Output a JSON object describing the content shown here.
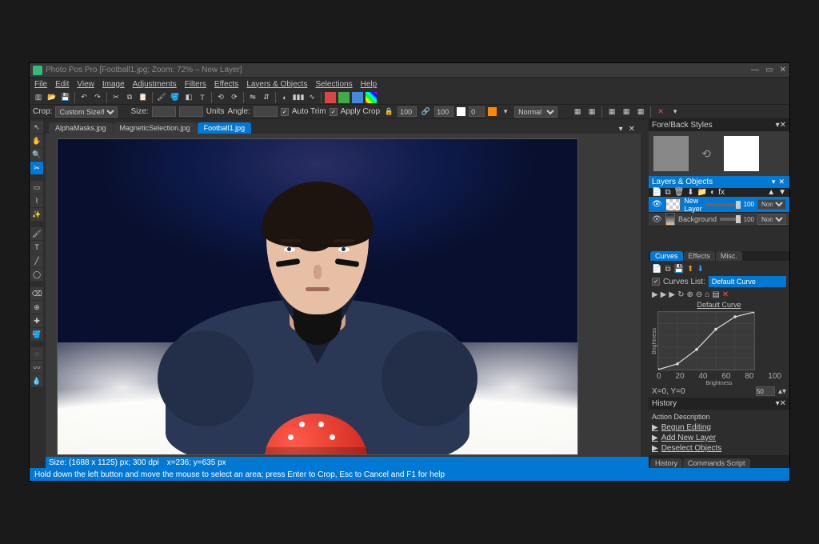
{
  "title": "Photo Pos Pro  [Football1.jpg; Zoom: 72% – New Layer]",
  "menu": [
    "File",
    "Edit",
    "View",
    "Image",
    "Adjustments",
    "Filters",
    "Effects",
    "Layers & Objects",
    "Selections",
    "Help"
  ],
  "crop_bar": {
    "crop_lbl": "Crop:",
    "crop_mode": "Custom Size/Ratio",
    "size_lbl": "Size:",
    "size_w": "",
    "size_h": "",
    "units": "Units",
    "angle_lbl": "Angle:",
    "angle": "",
    "auto_trim": "Auto Trim",
    "apply_crop": "Apply Crop",
    "w_val": "100",
    "h_val": "100",
    "opacity_val": "0",
    "blend_mode": "Normal"
  },
  "tabs": [
    "AlphaMasks.jpg",
    "MagneticSelection.jpg",
    "Football1.jpg"
  ],
  "active_tab": 2,
  "fore_back": {
    "title": "Fore/Back Styles"
  },
  "layers_panel": {
    "title": "Layers & Objects",
    "layers": [
      {
        "name": "New Layer",
        "opacity": 100,
        "selected": true,
        "checker": true
      },
      {
        "name": "Background",
        "opacity": 100,
        "selected": false,
        "checker": false
      }
    ],
    "blend_short": "Norm."
  },
  "curves_panel": {
    "tabs": [
      "Curves",
      "Effects",
      "Misc."
    ],
    "list_lbl": "Curves List:",
    "list_val": "Default Curve",
    "title": "Default Curve",
    "ylabel": "Brightness",
    "xlabel": "Brightness",
    "coord": "X=0, Y=0",
    "spin": "50",
    "axis": [
      "0",
      "20",
      "40",
      "60",
      "80",
      "100"
    ]
  },
  "chart_data": {
    "type": "line",
    "x": [
      0,
      20,
      40,
      60,
      80,
      100
    ],
    "y": [
      0,
      10,
      35,
      70,
      92,
      100
    ],
    "title": "Default Curve",
    "xlabel": "Brightness",
    "ylabel": "Brightness",
    "xlim": [
      0,
      100
    ],
    "ylim": [
      0,
      100
    ]
  },
  "history_panel": {
    "title": "History",
    "hdr": "Action Description",
    "items": [
      "Begun Editing",
      "Add New Layer",
      "Deselect Objects"
    ]
  },
  "footer_tabs": [
    "History",
    "Commands Script"
  ],
  "status": {
    "size": "Size: (1688 x 1125) px; 300 dpi",
    "pos": "x=236; y=635 px"
  },
  "hint": "Hold down the left button and move the mouse to select an area; press Enter to Crop, Esc to Cancel and F1 for help"
}
